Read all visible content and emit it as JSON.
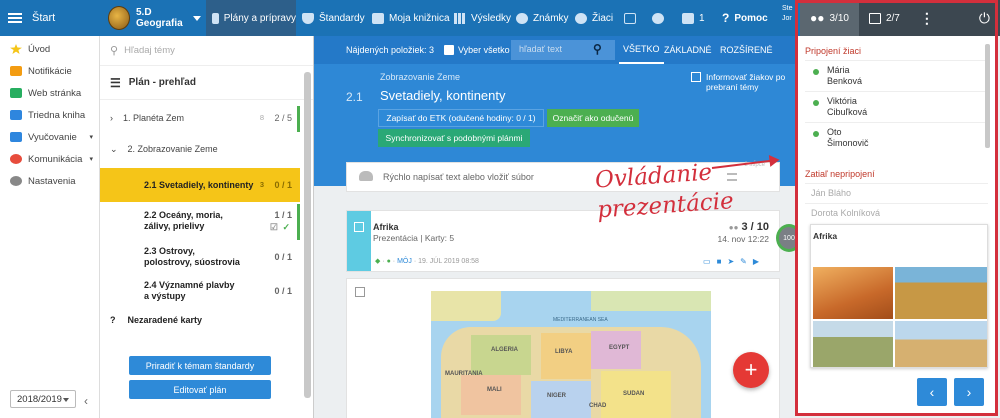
{
  "topbar": {
    "start_label": "Štart",
    "class_name": "5.D",
    "class_subject": "Geografia",
    "nav": [
      "Plány a prípravy",
      "Štandardy",
      "Moja knižnica",
      "Výsledky",
      "Známky",
      "Žiaci"
    ],
    "messages_count": "1",
    "help_label": "Pomoc",
    "user_short1": "Ste",
    "user_short2": "Jor"
  },
  "controls": {
    "students_count": "3/10",
    "slides_count": "2/7"
  },
  "sidebar": {
    "items": [
      "Úvod",
      "Notifikácie",
      "Web stránka",
      "Triedna kniha",
      "Vyučovanie",
      "Komunikácia",
      "Nastavenia"
    ],
    "year": "2018/2019"
  },
  "tree": {
    "search_placeholder": "Hľadaj témy",
    "title": "Plán - prehľad",
    "nodes": [
      {
        "label": "1. Planéta Zem",
        "small": "8",
        "count": "2 / 5"
      },
      {
        "label": "2. Zobrazovanie Zeme",
        "small": "",
        "count": ""
      },
      {
        "label": "2.1 Svetadiely, kontinenty",
        "small": "3",
        "count": "0 / 1"
      },
      {
        "label": "2.2 Oceány, moria, zálivy, prielivy",
        "small": "",
        "count": "1 / 1"
      },
      {
        "label": "2.3 Ostrovy, polostrovy, súostrovia",
        "small": "",
        "count": "0 / 1"
      },
      {
        "label": "2.4 Významné plavby a výstupy",
        "small": "",
        "count": "0 / 1"
      },
      {
        "label": "Nezaradené karty",
        "small": "",
        "count": ""
      }
    ],
    "assign_label": "Priradiť k témam štandardy",
    "edit_label": "Editovať plán"
  },
  "filter": {
    "found_label": "Nájdených položiek: 3",
    "select_all_label": "Vyber všetko",
    "search_placeholder": "hľadať text",
    "tabs": [
      "VŠETKO",
      "ZÁKLADNÉ",
      "ROZŠÍRENÉ"
    ]
  },
  "topic": {
    "parent": "Zobrazovanie Zeme",
    "number": "2.1",
    "title": "Svetadiely, kontinenty",
    "etk_label": "Zapísať do ETK (odučené hodiny: 0 / 1)",
    "taught_label": "Označiť ako odučenú",
    "sync_label": "Synchronizovať s podobnými plánmi",
    "inform_label": "Informovať žiakov po prebraní témy"
  },
  "quick": {
    "placeholder": "Rýchlo napísať text alebo vložiť súbor",
    "hint": "2 stĺpce"
  },
  "card": {
    "title": "Afrika",
    "type": "Prezentácia",
    "slides": "Karty: 5",
    "owner": "MÔJ",
    "date": "19. JÚL 2019 08:58",
    "students": "3 / 10",
    "shown": "14. nov 12:22",
    "progress": "100"
  },
  "map_labels": [
    "MEDITERRANEAN SEA",
    "ALGERIA",
    "LIBYA",
    "EGYPT",
    "MALI",
    "NIGER",
    "SUDAN",
    "MAURITANIA",
    "CHAD"
  ],
  "right_panel": {
    "connected_title": "Pripojení žiaci",
    "connected": [
      "Mária Benková",
      "Viktória Cibuľková",
      "Oto Šimonovič"
    ],
    "not_connected_title": "Zatiaľ nepripojení",
    "not_connected": [
      "Ján Bláho",
      "Dorota Kolníková"
    ],
    "preview_title": "Afrika"
  },
  "annotation": {
    "line1": "Ovládanie",
    "line2": "prezentácie"
  },
  "colors": {
    "topbar": "#1b72b5",
    "accent_yellow": "#f5c518",
    "green": "#4caf50",
    "red_annotation": "#d32f3c"
  }
}
